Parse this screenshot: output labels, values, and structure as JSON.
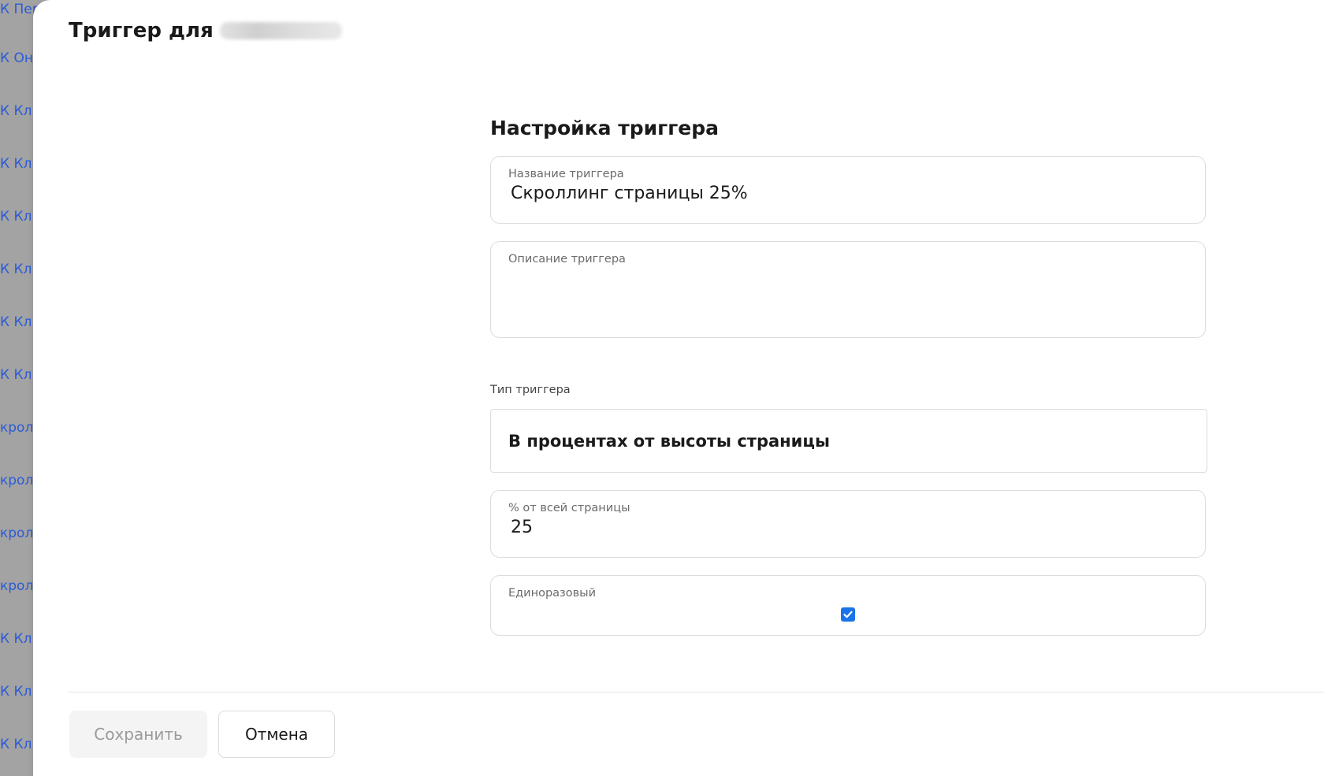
{
  "background_list": {
    "items": [
      "К Пер",
      "К Он",
      "К Кл",
      "К Кл",
      "К Кл",
      "К Кл",
      "К Кл",
      "К Кл",
      "крол",
      "крол",
      "крол",
      "крол",
      "К Кл",
      "К Кл",
      "К Кл"
    ]
  },
  "panel": {
    "title": "Триггер для"
  },
  "form": {
    "section_title": "Настройка триггера",
    "name_label": "Название триггера",
    "name_value": "Скроллинг страницы 25%",
    "description_label": "Описание триггера",
    "description_value": "",
    "type_label": "Тип триггера",
    "type_value": "В процентах от высоты страницы",
    "percent_label": "% от всей страницы",
    "percent_value": "25",
    "once_label": "Единоразовый",
    "once_checked": true
  },
  "footer": {
    "save_label": "Сохранить",
    "cancel_label": "Отмена"
  },
  "colors": {
    "accent": "#1a73e8",
    "link": "#2a5bd7"
  }
}
